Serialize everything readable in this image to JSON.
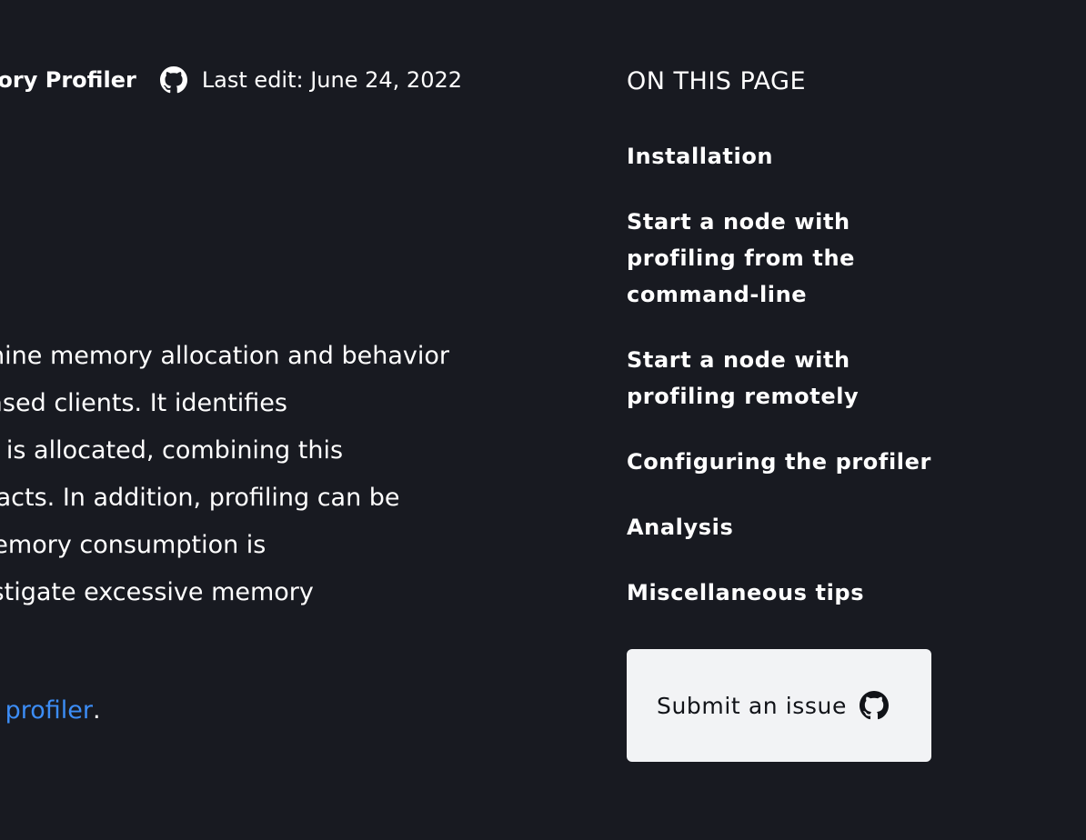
{
  "meta": {
    "doc_title": "Memory Profiler",
    "last_edit": "Last edit: June 24, 2022"
  },
  "body": {
    "lines": [
      "Memory profiling lets you examine memory allocation and behavior",
      "of Substrate-based clients. It identifies",
      "where memory is allocated, combining this",
      "with other artifacts. In addition, profiling can be",
      "useful when memory consumption is",
      "high or to investigate excessive memory"
    ],
    "link_text": "memory profiler",
    "link_suffix": "."
  },
  "toc": {
    "heading": "ON THIS PAGE",
    "items": [
      "Installation",
      "Start a node with profiling from the command-line",
      "Start a node with profiling remotely",
      "Configuring the profiler",
      "Analysis",
      "Miscellaneous tips"
    ]
  },
  "issue_button": {
    "label": "Submit an issue",
    "icon": "github-icon"
  },
  "colors": {
    "background": "#181a21",
    "link": "#3c8df6",
    "button_bg": "#f2f3f5"
  }
}
